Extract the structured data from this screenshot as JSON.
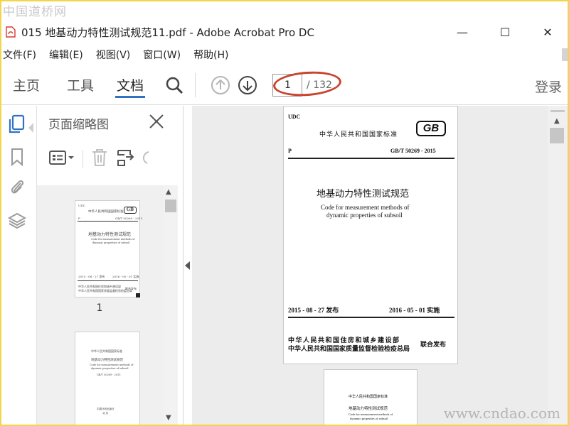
{
  "watermarks": {
    "top_left": "中国道桥网",
    "bottom_right": "www.cndao.com"
  },
  "window": {
    "title": "015 地基动力特性测试规范11.pdf - Adobe Acrobat Pro DC",
    "controls": {
      "minimize": "—",
      "maximize": "☐",
      "close": "✕"
    }
  },
  "menu": {
    "items": [
      "文件(F)",
      "编辑(E)",
      "视图(V)",
      "窗口(W)",
      "帮助(H)"
    ]
  },
  "toolbar": {
    "tabs": [
      "主页",
      "工具",
      "文档"
    ],
    "active_tab": "文档",
    "page_current": "1",
    "page_total": "/ 132",
    "login": "登录",
    "icons": [
      "search-icon",
      "prev-page-icon",
      "next-page-icon"
    ]
  },
  "thumbnail_panel": {
    "title": "页面缩略图",
    "page1_label": "1",
    "thumb1": {
      "udc": "UDC",
      "header": "中华人民共和国国家标准",
      "p": "P",
      "code": "GB/T 50269 - 2015",
      "title": "地基动力特性测试规范",
      "en1": "Code for measurement methods of",
      "en2": "dynamic properties of subsoil",
      "date1": "2015 - 08 - 27 发布",
      "date2": "2016 - 05 - 01 实施",
      "issuer1": "中华人民共和国住房和城乡建设部",
      "issuer2": "中华人民共和国国家质量监督检验检疫总局",
      "joint": "联合发布"
    },
    "thumb2": {
      "l1": "中华人民共和国国家标准",
      "l2": "地基动力特性测试规范",
      "l3": "Code for measurement methods of",
      "l4": "dynamic properties of subsoil",
      "l5": "GB/T 50269 - 2015",
      "l6": "中国计划出版社",
      "l7": "北 京"
    }
  },
  "document": {
    "page1": {
      "udc": "UDC",
      "header": "中华人民共和国国家标准",
      "logo": "GB",
      "p": "P",
      "code": "GB/T 50269 - 2015",
      "title": "地基动力特性测试规范",
      "en1": "Code for measurement methods of",
      "en2": "dynamic properties of subsoil",
      "date_issue": "2015 - 08 - 27   发布",
      "date_effective": "2016 - 05 - 01   实施",
      "issuer1": "中华人民共和国住房和城乡建设部",
      "issuer2": "中华人民共和国国家质量监督检验检疫总局",
      "joint": "联合发布"
    },
    "page2": {
      "l1": "中华人民共和国国家标准",
      "l2": "地基动力特性测试规范",
      "l3": "Code for measurement methods of",
      "l4": "dynamic properties of subsoil"
    }
  },
  "colors": {
    "accent": "#2f72c4",
    "annotation_oval": "#c9452c",
    "pdf_icon": "#d8382d"
  }
}
